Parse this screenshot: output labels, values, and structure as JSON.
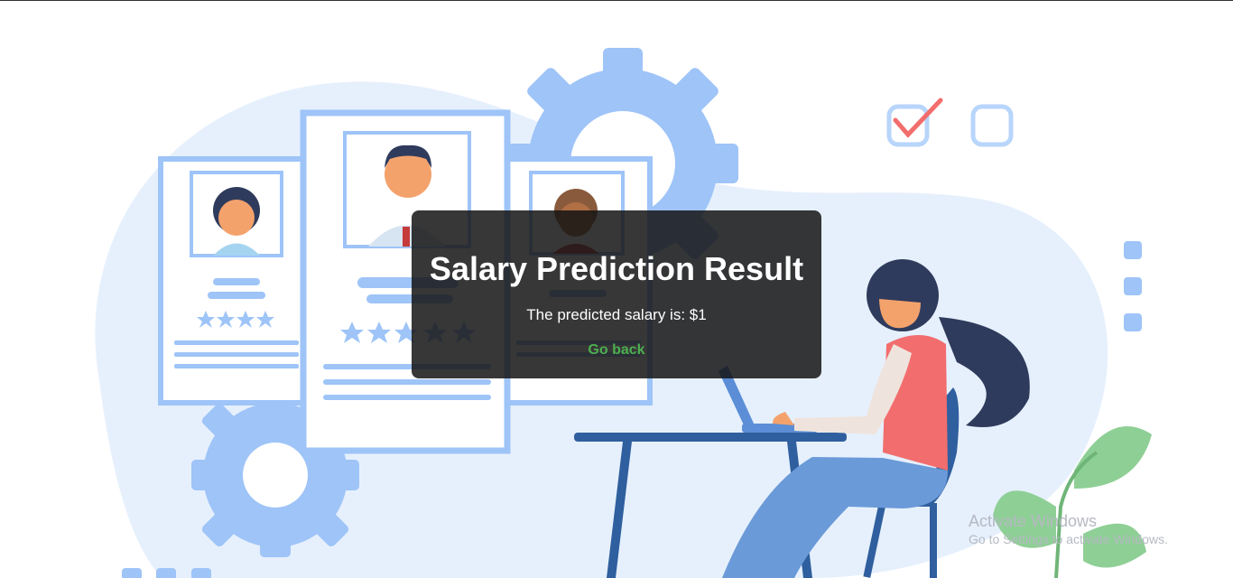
{
  "result": {
    "title": "Salary Prediction Result",
    "message": "The predicted salary is: $1",
    "back_link": "Go back"
  },
  "watermark": {
    "line1": "Activate Windows",
    "line2": "Go to Settings to activate Windows."
  },
  "colors": {
    "link": "#4caf50",
    "modal_bg": "rgba(20,20,20,0.85)",
    "illustration_light": "#e6f0fd",
    "illustration_blue": "#9ec4f8",
    "accent_red": "#f26d6d"
  },
  "icons": [
    "gear-icon",
    "checkbox-checked-icon",
    "checkbox-empty-icon",
    "star-icon",
    "leaf-icon"
  ]
}
